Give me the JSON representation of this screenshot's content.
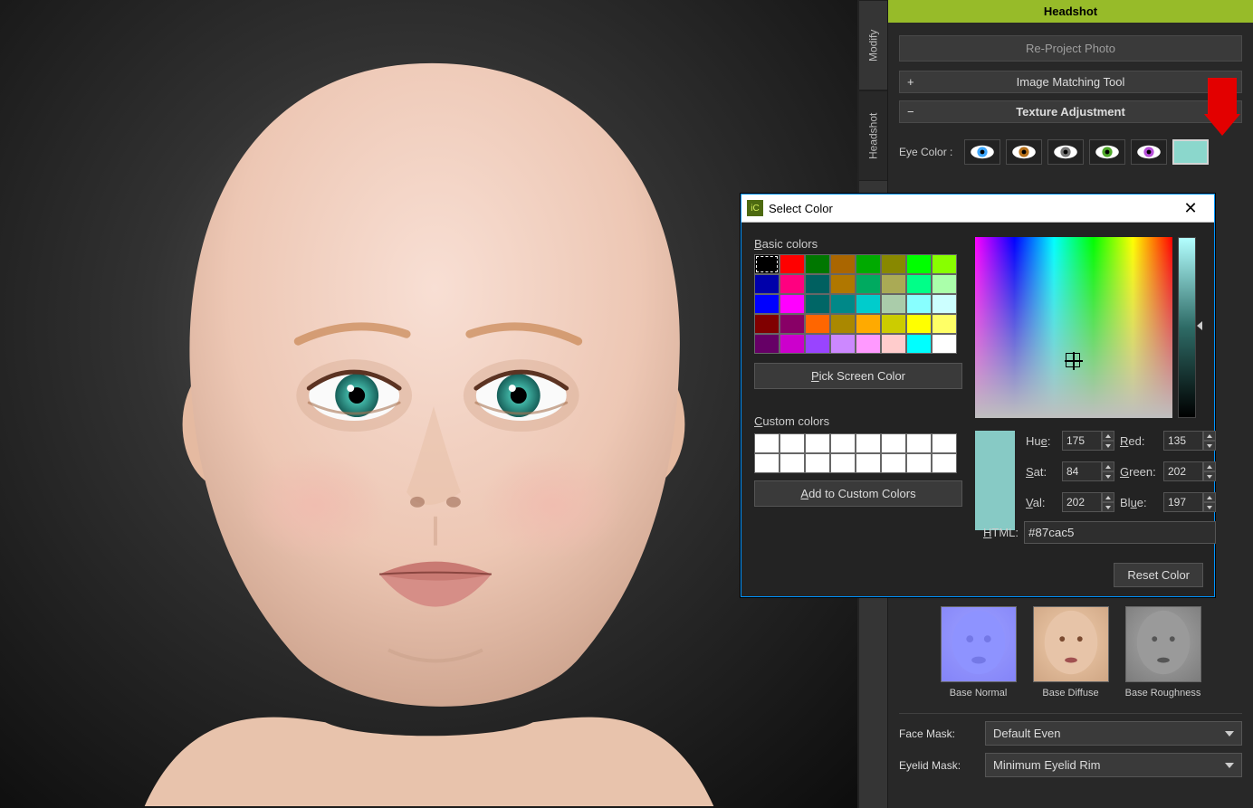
{
  "sideTabs": {
    "modify": "Modify",
    "headshot": "Headshot"
  },
  "panel": {
    "title": "Headshot",
    "reproject": "Re-Project Photo",
    "matching": "Image Matching Tool",
    "textureAdj": "Texture Adjustment",
    "eyeColorLabel": "Eye Color :",
    "eyeColors": [
      "#3ea8ff",
      "#b77019",
      "#777777",
      "#4fa82a",
      "#b74fd9"
    ],
    "eyeColorCustom": "#8bd7cc",
    "tex": {
      "normal": "Base Normal",
      "diffuse": "Base Diffuse",
      "rough": "Base Roughness"
    },
    "faceMaskLabel": "Face Mask:",
    "faceMaskValue": "Default Even",
    "eyelidMaskLabel": "Eyelid Mask:",
    "eyelidMaskValue": "Minimum Eyelid Rim"
  },
  "dialog": {
    "title": "Select Color",
    "basicLabel": "Basic colors",
    "pickScreen": "Pick Screen Color",
    "customLabel": "Custom colors",
    "addCustom": "Add to Custom Colors",
    "hueLabel": "Hue:",
    "satLabel": "Sat:",
    "valLabel": "Val:",
    "redLabel": "Red:",
    "greenLabel": "Green:",
    "blueLabel": "Blue:",
    "htmlLabel": "HTML:",
    "reset": "Reset Color",
    "hue": "175",
    "sat": "84",
    "val": "202",
    "red": "135",
    "green": "202",
    "blue": "197",
    "html": "#87cac5",
    "basic": [
      "#000000",
      "#ff0000",
      "#007700",
      "#aa6600",
      "#00aa00",
      "#888800",
      "#00ff00",
      "#88ff00",
      "#0000aa",
      "#ff0080",
      "#006060",
      "#b07700",
      "#00aa60",
      "#aaaa55",
      "#00ff88",
      "#aaffaa",
      "#0000ff",
      "#ff00ff",
      "#006666",
      "#008888",
      "#00cccc",
      "#aaccaa",
      "#88ffff",
      "#ccffff",
      "#800000",
      "#880066",
      "#ff6600",
      "#aa8800",
      "#ffaa00",
      "#cccc00",
      "#ffff00",
      "#ffff66",
      "#660066",
      "#cc00cc",
      "#9944ff",
      "#cc88ff",
      "#ff99ff",
      "#ffcccc",
      "#00ffff",
      "#ffffff"
    ]
  }
}
